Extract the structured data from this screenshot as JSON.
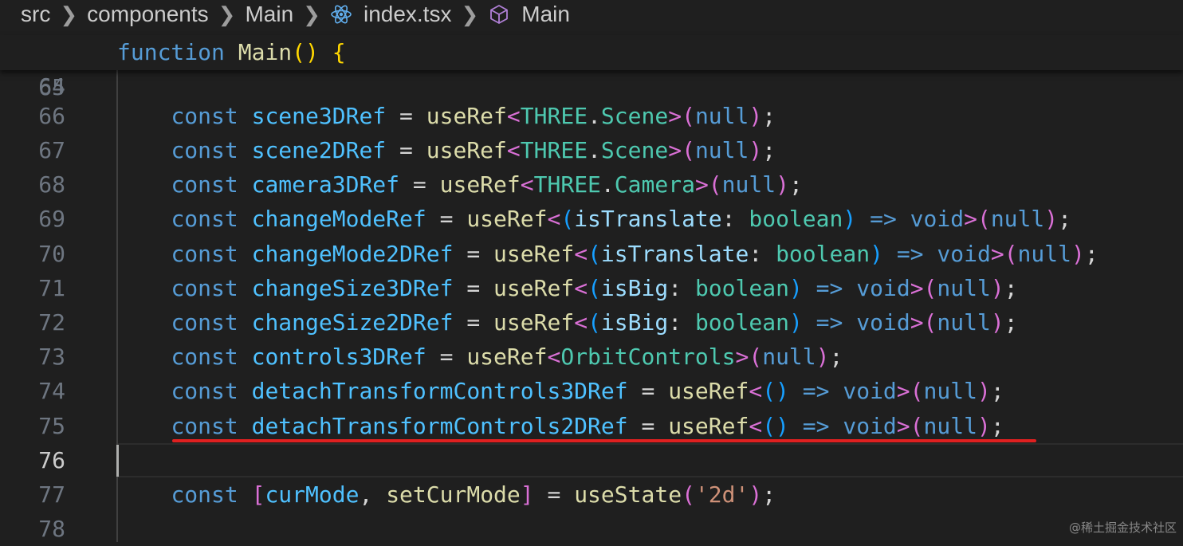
{
  "breadcrumb": {
    "items": [
      "src",
      "components",
      "Main",
      "index.tsx",
      "Main"
    ],
    "file_icon": "react-icon",
    "symbol_icon": "cube-icon"
  },
  "editor": {
    "sticky_line": {
      "number": "64",
      "tokens": [
        {
          "t": "function",
          "c": "k"
        },
        {
          "t": " ",
          "c": "p"
        },
        {
          "t": "Main",
          "c": "fn"
        },
        {
          "t": "()",
          "c": "br1"
        },
        {
          "t": " ",
          "c": "p"
        },
        {
          "t": "{",
          "c": "br1"
        }
      ]
    },
    "active_line": "76",
    "highlighted_line": "75",
    "lines": [
      {
        "number": "65",
        "tokens": []
      },
      {
        "number": "66",
        "tokens": [
          {
            "t": "    ",
            "c": "p"
          },
          {
            "t": "const",
            "c": "k"
          },
          {
            "t": " ",
            "c": "p"
          },
          {
            "t": "scene3DRef",
            "c": "v"
          },
          {
            "t": " = ",
            "c": "p"
          },
          {
            "t": "useRef",
            "c": "fn"
          },
          {
            "t": "<",
            "c": "br2"
          },
          {
            "t": "THREE",
            "c": "ty"
          },
          {
            "t": ".",
            "c": "p"
          },
          {
            "t": "Scene",
            "c": "ty"
          },
          {
            "t": ">",
            "c": "br2"
          },
          {
            "t": "(",
            "c": "br2"
          },
          {
            "t": "null",
            "c": "k"
          },
          {
            "t": ")",
            "c": "br2"
          },
          {
            "t": ";",
            "c": "p"
          }
        ]
      },
      {
        "number": "67",
        "tokens": [
          {
            "t": "    ",
            "c": "p"
          },
          {
            "t": "const",
            "c": "k"
          },
          {
            "t": " ",
            "c": "p"
          },
          {
            "t": "scene2DRef",
            "c": "v"
          },
          {
            "t": " = ",
            "c": "p"
          },
          {
            "t": "useRef",
            "c": "fn"
          },
          {
            "t": "<",
            "c": "br2"
          },
          {
            "t": "THREE",
            "c": "ty"
          },
          {
            "t": ".",
            "c": "p"
          },
          {
            "t": "Scene",
            "c": "ty"
          },
          {
            "t": ">",
            "c": "br2"
          },
          {
            "t": "(",
            "c": "br2"
          },
          {
            "t": "null",
            "c": "k"
          },
          {
            "t": ")",
            "c": "br2"
          },
          {
            "t": ";",
            "c": "p"
          }
        ]
      },
      {
        "number": "68",
        "tokens": [
          {
            "t": "    ",
            "c": "p"
          },
          {
            "t": "const",
            "c": "k"
          },
          {
            "t": " ",
            "c": "p"
          },
          {
            "t": "camera3DRef",
            "c": "v"
          },
          {
            "t": " = ",
            "c": "p"
          },
          {
            "t": "useRef",
            "c": "fn"
          },
          {
            "t": "<",
            "c": "br2"
          },
          {
            "t": "THREE",
            "c": "ty"
          },
          {
            "t": ".",
            "c": "p"
          },
          {
            "t": "Camera",
            "c": "ty"
          },
          {
            "t": ">",
            "c": "br2"
          },
          {
            "t": "(",
            "c": "br2"
          },
          {
            "t": "null",
            "c": "k"
          },
          {
            "t": ")",
            "c": "br2"
          },
          {
            "t": ";",
            "c": "p"
          }
        ]
      },
      {
        "number": "69",
        "tokens": [
          {
            "t": "    ",
            "c": "p"
          },
          {
            "t": "const",
            "c": "k"
          },
          {
            "t": " ",
            "c": "p"
          },
          {
            "t": "changeModeRef",
            "c": "v"
          },
          {
            "t": " = ",
            "c": "p"
          },
          {
            "t": "useRef",
            "c": "fn"
          },
          {
            "t": "<",
            "c": "br2"
          },
          {
            "t": "(",
            "c": "br3"
          },
          {
            "t": "isTranslate",
            "c": "pa"
          },
          {
            "t": ": ",
            "c": "p"
          },
          {
            "t": "boolean",
            "c": "ty"
          },
          {
            "t": ")",
            "c": "br3"
          },
          {
            "t": " ",
            "c": "p"
          },
          {
            "t": "=>",
            "c": "k"
          },
          {
            "t": " ",
            "c": "p"
          },
          {
            "t": "void",
            "c": "k"
          },
          {
            "t": ">",
            "c": "br2"
          },
          {
            "t": "(",
            "c": "br2"
          },
          {
            "t": "null",
            "c": "k"
          },
          {
            "t": ")",
            "c": "br2"
          },
          {
            "t": ";",
            "c": "p"
          }
        ]
      },
      {
        "number": "70",
        "tokens": [
          {
            "t": "    ",
            "c": "p"
          },
          {
            "t": "const",
            "c": "k"
          },
          {
            "t": " ",
            "c": "p"
          },
          {
            "t": "changeMode2DRef",
            "c": "v"
          },
          {
            "t": " = ",
            "c": "p"
          },
          {
            "t": "useRef",
            "c": "fn"
          },
          {
            "t": "<",
            "c": "br2"
          },
          {
            "t": "(",
            "c": "br3"
          },
          {
            "t": "isTranslate",
            "c": "pa"
          },
          {
            "t": ": ",
            "c": "p"
          },
          {
            "t": "boolean",
            "c": "ty"
          },
          {
            "t": ")",
            "c": "br3"
          },
          {
            "t": " ",
            "c": "p"
          },
          {
            "t": "=>",
            "c": "k"
          },
          {
            "t": " ",
            "c": "p"
          },
          {
            "t": "void",
            "c": "k"
          },
          {
            "t": ">",
            "c": "br2"
          },
          {
            "t": "(",
            "c": "br2"
          },
          {
            "t": "null",
            "c": "k"
          },
          {
            "t": ")",
            "c": "br2"
          },
          {
            "t": ";",
            "c": "p"
          }
        ]
      },
      {
        "number": "71",
        "tokens": [
          {
            "t": "    ",
            "c": "p"
          },
          {
            "t": "const",
            "c": "k"
          },
          {
            "t": " ",
            "c": "p"
          },
          {
            "t": "changeSize3DRef",
            "c": "v"
          },
          {
            "t": " = ",
            "c": "p"
          },
          {
            "t": "useRef",
            "c": "fn"
          },
          {
            "t": "<",
            "c": "br2"
          },
          {
            "t": "(",
            "c": "br3"
          },
          {
            "t": "isBig",
            "c": "pa"
          },
          {
            "t": ": ",
            "c": "p"
          },
          {
            "t": "boolean",
            "c": "ty"
          },
          {
            "t": ")",
            "c": "br3"
          },
          {
            "t": " ",
            "c": "p"
          },
          {
            "t": "=>",
            "c": "k"
          },
          {
            "t": " ",
            "c": "p"
          },
          {
            "t": "void",
            "c": "k"
          },
          {
            "t": ">",
            "c": "br2"
          },
          {
            "t": "(",
            "c": "br2"
          },
          {
            "t": "null",
            "c": "k"
          },
          {
            "t": ")",
            "c": "br2"
          },
          {
            "t": ";",
            "c": "p"
          }
        ]
      },
      {
        "number": "72",
        "tokens": [
          {
            "t": "    ",
            "c": "p"
          },
          {
            "t": "const",
            "c": "k"
          },
          {
            "t": " ",
            "c": "p"
          },
          {
            "t": "changeSize2DRef",
            "c": "v"
          },
          {
            "t": " = ",
            "c": "p"
          },
          {
            "t": "useRef",
            "c": "fn"
          },
          {
            "t": "<",
            "c": "br2"
          },
          {
            "t": "(",
            "c": "br3"
          },
          {
            "t": "isBig",
            "c": "pa"
          },
          {
            "t": ": ",
            "c": "p"
          },
          {
            "t": "boolean",
            "c": "ty"
          },
          {
            "t": ")",
            "c": "br3"
          },
          {
            "t": " ",
            "c": "p"
          },
          {
            "t": "=>",
            "c": "k"
          },
          {
            "t": " ",
            "c": "p"
          },
          {
            "t": "void",
            "c": "k"
          },
          {
            "t": ">",
            "c": "br2"
          },
          {
            "t": "(",
            "c": "br2"
          },
          {
            "t": "null",
            "c": "k"
          },
          {
            "t": ")",
            "c": "br2"
          },
          {
            "t": ";",
            "c": "p"
          }
        ]
      },
      {
        "number": "73",
        "tokens": [
          {
            "t": "    ",
            "c": "p"
          },
          {
            "t": "const",
            "c": "k"
          },
          {
            "t": " ",
            "c": "p"
          },
          {
            "t": "controls3DRef",
            "c": "v"
          },
          {
            "t": " = ",
            "c": "p"
          },
          {
            "t": "useRef",
            "c": "fn"
          },
          {
            "t": "<",
            "c": "br2"
          },
          {
            "t": "OrbitControls",
            "c": "ty"
          },
          {
            "t": ">",
            "c": "br2"
          },
          {
            "t": "(",
            "c": "br2"
          },
          {
            "t": "null",
            "c": "k"
          },
          {
            "t": ")",
            "c": "br2"
          },
          {
            "t": ";",
            "c": "p"
          }
        ]
      },
      {
        "number": "74",
        "tokens": [
          {
            "t": "    ",
            "c": "p"
          },
          {
            "t": "const",
            "c": "k"
          },
          {
            "t": " ",
            "c": "p"
          },
          {
            "t": "detachTransformControls3DRef",
            "c": "v"
          },
          {
            "t": " = ",
            "c": "p"
          },
          {
            "t": "useRef",
            "c": "fn"
          },
          {
            "t": "<",
            "c": "br2"
          },
          {
            "t": "()",
            "c": "br3"
          },
          {
            "t": " ",
            "c": "p"
          },
          {
            "t": "=>",
            "c": "k"
          },
          {
            "t": " ",
            "c": "p"
          },
          {
            "t": "void",
            "c": "k"
          },
          {
            "t": ">",
            "c": "br2"
          },
          {
            "t": "(",
            "c": "br2"
          },
          {
            "t": "null",
            "c": "k"
          },
          {
            "t": ")",
            "c": "br2"
          },
          {
            "t": ";",
            "c": "p"
          }
        ]
      },
      {
        "number": "75",
        "tokens": [
          {
            "t": "    ",
            "c": "p"
          },
          {
            "t": "const",
            "c": "k"
          },
          {
            "t": " ",
            "c": "p"
          },
          {
            "t": "detachTransformControls2DRef",
            "c": "v"
          },
          {
            "t": " = ",
            "c": "p"
          },
          {
            "t": "useRef",
            "c": "fn"
          },
          {
            "t": "<",
            "c": "br2"
          },
          {
            "t": "()",
            "c": "br3"
          },
          {
            "t": " ",
            "c": "p"
          },
          {
            "t": "=>",
            "c": "k"
          },
          {
            "t": " ",
            "c": "p"
          },
          {
            "t": "void",
            "c": "k"
          },
          {
            "t": ">",
            "c": "br2"
          },
          {
            "t": "(",
            "c": "br2"
          },
          {
            "t": "null",
            "c": "k"
          },
          {
            "t": ")",
            "c": "br2"
          },
          {
            "t": ";",
            "c": "p"
          }
        ]
      },
      {
        "number": "76",
        "tokens": []
      },
      {
        "number": "77",
        "tokens": [
          {
            "t": "    ",
            "c": "p"
          },
          {
            "t": "const",
            "c": "k"
          },
          {
            "t": " ",
            "c": "p"
          },
          {
            "t": "[",
            "c": "br2"
          },
          {
            "t": "curMode",
            "c": "v"
          },
          {
            "t": ", ",
            "c": "p"
          },
          {
            "t": "setCurMode",
            "c": "fn"
          },
          {
            "t": "]",
            "c": "br2"
          },
          {
            "t": " = ",
            "c": "p"
          },
          {
            "t": "useState",
            "c": "fn"
          },
          {
            "t": "(",
            "c": "br2"
          },
          {
            "t": "'2d'",
            "c": "s"
          },
          {
            "t": ")",
            "c": "br2"
          },
          {
            "t": ";",
            "c": "p"
          }
        ]
      },
      {
        "number": "78",
        "tokens": []
      }
    ]
  },
  "watermark": "@稀土掘金技术社区",
  "colors": {
    "background": "#1f1f1f",
    "annotation_underline": "#e02020",
    "keyword": "#569cd6",
    "variable": "#4fc1ff",
    "function": "#dcdcaa",
    "type": "#4ec9b0"
  }
}
